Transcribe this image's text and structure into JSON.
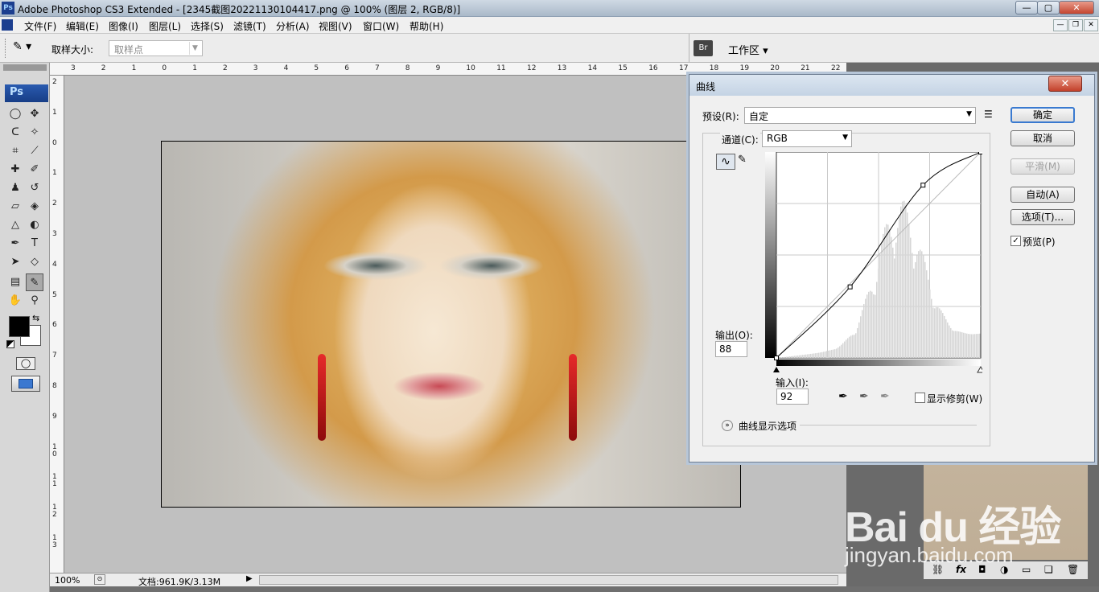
{
  "window": {
    "title": "Adobe Photoshop CS3 Extended - [2345截图20221130104417.png @ 100% (图层 2, RGB/8)]",
    "app_icon": "Ps",
    "controls": [
      "—",
      "▢",
      "✕"
    ]
  },
  "menu": {
    "items": [
      "文件(F)",
      "编辑(E)",
      "图像(I)",
      "图层(L)",
      "选择(S)",
      "滤镜(T)",
      "分析(A)",
      "视图(V)",
      "窗口(W)",
      "帮助(H)"
    ],
    "doc_controls": [
      "—",
      "❐",
      "✕"
    ]
  },
  "options": {
    "sample_size_label": "取样大小:",
    "sample_size_value": "取样点",
    "workspace_label": "工作区 ▾"
  },
  "tools": {
    "badge": "Ps",
    "icons": [
      "marquee-icon",
      "move-icon",
      "lasso-icon",
      "magic-wand-icon",
      "crop-icon",
      "slice-icon",
      "healing-icon",
      "brush-icon",
      "stamp-icon",
      "history-brush-icon",
      "eraser-icon",
      "paint-bucket-icon",
      "blur-icon",
      "dodge-icon",
      "pen-icon",
      "type-icon",
      "path-select-icon",
      "shape-icon",
      "notes-icon",
      "eyedropper-icon",
      "hand-icon",
      "zoom-icon"
    ]
  },
  "ruler": {
    "top_ticks": [
      "3",
      "2",
      "1",
      "0",
      "1",
      "2",
      "3",
      "4",
      "5",
      "6",
      "7",
      "8",
      "9",
      "10",
      "11",
      "12",
      "13",
      "14",
      "15",
      "16",
      "17",
      "18",
      "19",
      "20",
      "21",
      "22"
    ],
    "left_ticks": [
      "2",
      "1",
      "0",
      "1",
      "2",
      "3",
      "4",
      "5",
      "6",
      "7",
      "8",
      "9",
      "1\n0",
      "1\n1",
      "1\n2",
      "1\n3"
    ]
  },
  "status": {
    "zoom": "100%",
    "doc_info": "文档:961.9K/3.13M"
  },
  "curves": {
    "title": "曲线",
    "close": "✕",
    "preset_label": "预设(R):",
    "preset_value": "自定",
    "channel_label": "通道(C):",
    "channel_value": "RGB",
    "output_label": "输出(O):",
    "output_value": "88",
    "input_label": "输入(I):",
    "input_value": "92",
    "show_clipping": "显示修剪(W)",
    "display_options": "曲线显示选项",
    "buttons": {
      "ok": "确定",
      "cancel": "取消",
      "smooth": "平滑(M)",
      "auto": "自动(A)",
      "options": "选项(T)..."
    },
    "preview_label": "预览(P)",
    "preview_checked": true,
    "curve_points": [
      [
        0,
        0
      ],
      [
        92,
        88
      ],
      [
        183,
        214
      ],
      [
        255,
        255
      ]
    ]
  },
  "watermark": {
    "logo": "Bai du 经验",
    "url": "jingyan.baidu.com"
  },
  "dock": {
    "layer_icons": [
      "link-icon",
      "fx-icon",
      "mask-icon",
      "adjustment-icon",
      "group-icon",
      "new-layer-icon",
      "trash-icon"
    ]
  }
}
